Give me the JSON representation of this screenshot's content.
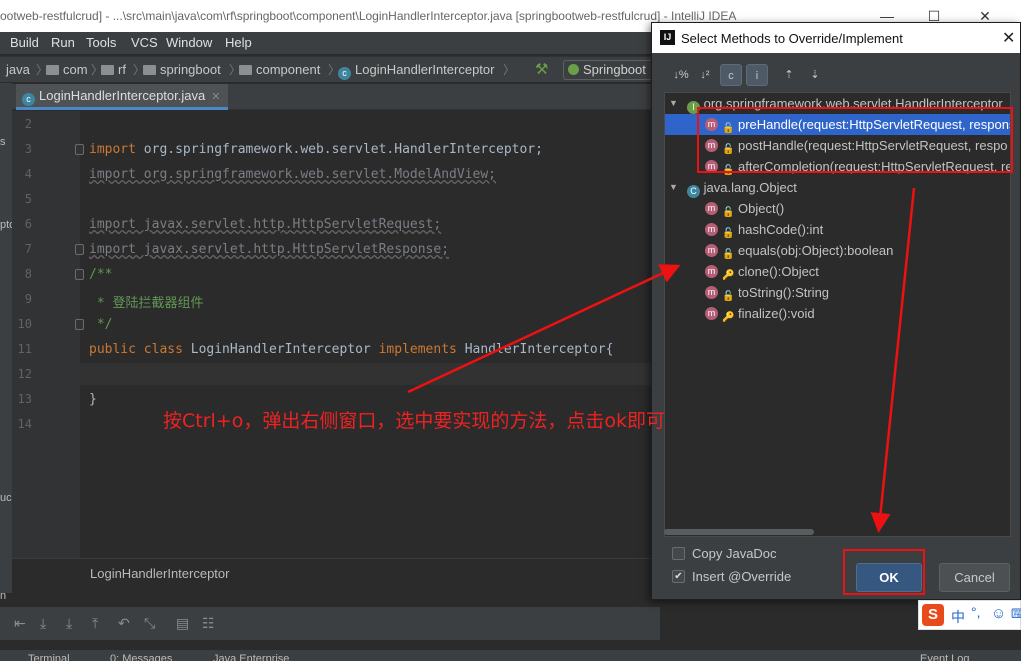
{
  "window": {
    "title": "ootweb-restfulcrud] - ...\\src\\main\\java\\com\\rf\\springboot\\component\\LoginHandlerInterceptor.java [springbootweb-restfulcrud] - IntelliJ IDEA",
    "minimize": "—",
    "maximize": "☐",
    "close": "✕"
  },
  "menu": [
    "Build",
    "Run",
    "Tools",
    "VCS",
    "Window",
    "Help"
  ],
  "breadcrumbs": [
    "java",
    "com",
    "rf",
    "springboot",
    "component",
    "LoginHandlerInterceptor"
  ],
  "run_config": "Springboot",
  "editor_tab": "LoginHandlerInterceptor.java",
  "left_strip_labels": [
    "s",
    "pto",
    "uc",
    "n"
  ],
  "code": {
    "line_numbers": [
      "2",
      "3",
      "4",
      "5",
      "6",
      "7",
      "8",
      "9",
      "10",
      "11",
      "12",
      "13",
      "14"
    ],
    "l3_kw": "import",
    "l3_rest": " org.springframework.web.servlet.HandlerInterceptor;",
    "l4": "import org.springframework.web.servlet.ModelAndView;",
    "l6": "import javax.servlet.http.HttpServletRequest;",
    "l7": "import javax.servlet.http.HttpServletResponse;",
    "l8": "/**",
    "l9_star": " * ",
    "l9_cn": "登陆拦截器组件",
    "l10": " */",
    "l11_kw1": "public class",
    "l11_name": " LoginHandlerInterceptor ",
    "l11_kw2": "implements",
    "l11_rest": " HandlerInterceptor{",
    "l13": "}"
  },
  "editor_breadcrumb": "LoginHandlerInterceptor",
  "status_items": [
    "Terminal",
    "0: Messages",
    "Java Enterprise",
    "Event Log"
  ],
  "dialog": {
    "title": "Select Methods to Override/Implement",
    "close": "✕",
    "toolbar": [
      "↓%",
      "↓²",
      "c",
      "i",
      "⇡",
      "⇣"
    ],
    "groups": [
      {
        "name": "org.springframework.web.servlet.HandlerInterceptor",
        "badge": "I",
        "methods": [
          {
            "label": "preHandle(request:HttpServletRequest, response",
            "selected": true
          },
          {
            "label": "postHandle(request:HttpServletRequest, respo",
            "selected": false
          },
          {
            "label": "afterCompletion(request:HttpServletRequest, re",
            "selected": false
          }
        ]
      },
      {
        "name": "java.lang.Object",
        "badge": "C",
        "methods": [
          {
            "label": "Object()",
            "selected": false
          },
          {
            "label": "hashCode():int",
            "selected": false
          },
          {
            "label": "equals(obj:Object):boolean",
            "selected": false
          },
          {
            "label": "clone():Object",
            "selected": false
          },
          {
            "label": "toString():String",
            "selected": false
          },
          {
            "label": "finalize():void",
            "selected": false
          }
        ]
      }
    ],
    "copy_javadoc": {
      "label": "Copy JavaDoc",
      "checked": false
    },
    "insert_override": {
      "label": "Insert @Override",
      "checked": true
    },
    "ok": "OK",
    "cancel": "Cancel"
  },
  "annotation": "按Ctrl+o，弹出右侧窗口，选中要实现的方法，点击ok即可",
  "ime": {
    "logo": "S",
    "mode": "中",
    "punct": "°,",
    "emoji": "☺",
    "kbd": "⌨"
  },
  "colors": {
    "annotation_red": "#ee1111",
    "selection_blue": "#2f65ca",
    "ok_blue": "#365880"
  }
}
